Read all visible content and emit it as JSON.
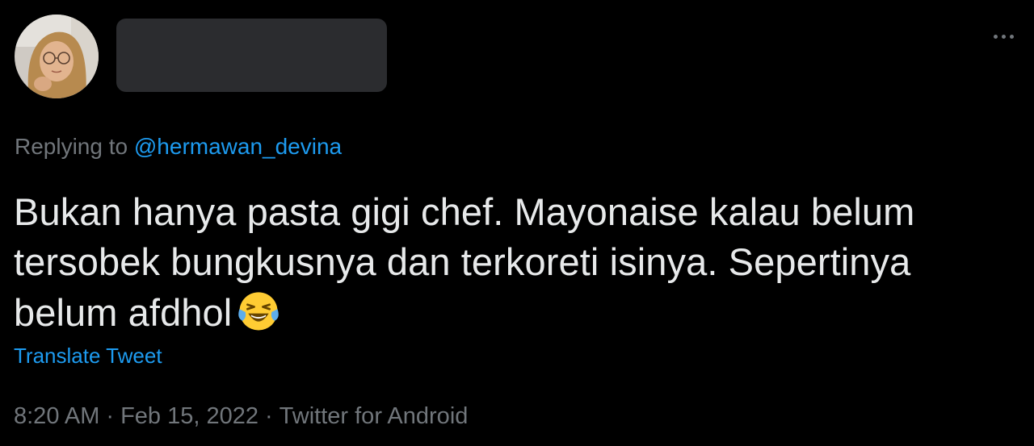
{
  "author": {
    "avatar_icon": "user-avatar-photo"
  },
  "reply": {
    "prefix": "Replying to",
    "mention": "@hermawan_devina"
  },
  "tweet": {
    "text_line1": "Bukan hanya pasta gigi chef. Mayonaise kalau belum",
    "text_line2": "tersobek bungkusnya dan terkoreti isinya. Sepertinya",
    "text_line3": "belum afdhol",
    "emoji": "face-with-tears-of-joy",
    "translate_label": "Translate Tweet"
  },
  "meta": {
    "time": "8:20 AM",
    "separator": "·",
    "date": "Feb 15, 2022",
    "source": "Twitter for Android"
  },
  "colors": {
    "background": "#000000",
    "text": "#e7e9ea",
    "secondary": "#71767b",
    "link": "#1d9bf0",
    "redaction": "#2b2c2f"
  }
}
